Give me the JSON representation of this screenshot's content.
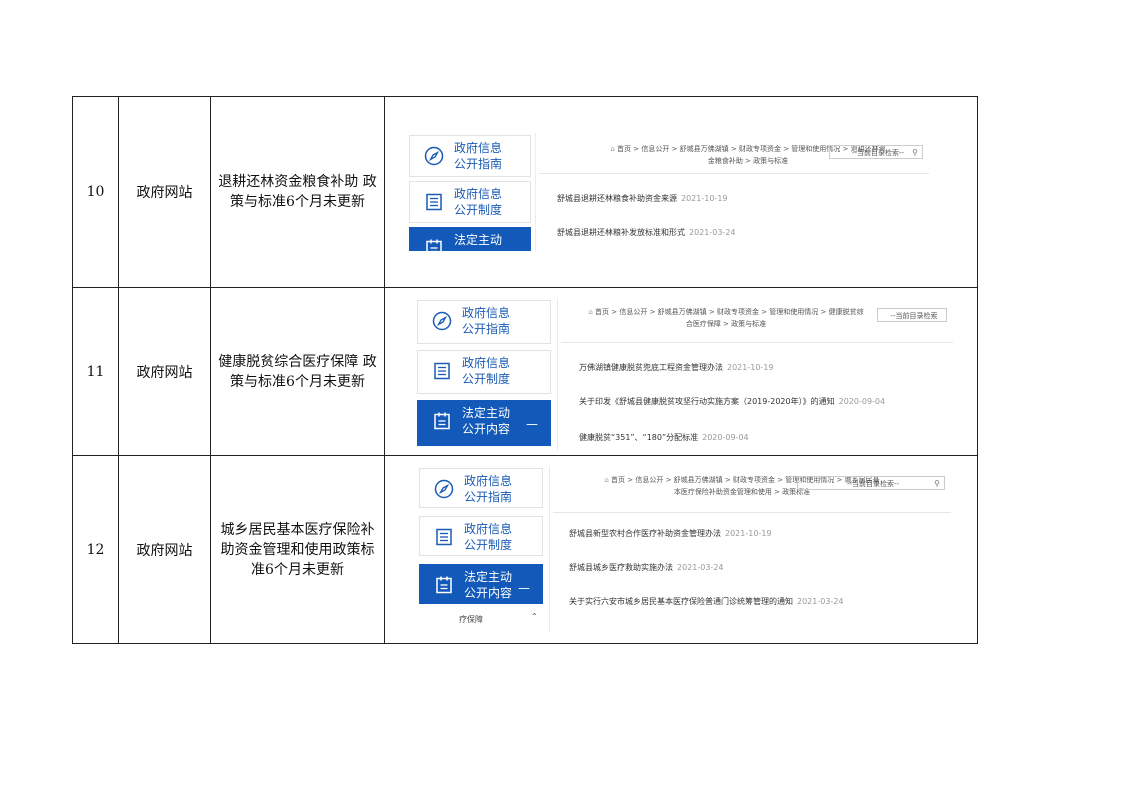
{
  "rows": [
    {
      "no": "10",
      "type": "政府网站",
      "desc_lines": [
        "退耕还林资金粮食补助 政",
        "策与标准6个月未更新"
      ],
      "shot": {
        "cards": [
          "政府信息|公开指南",
          "政府信息|公开制度",
          "法定主动|"
        ],
        "breadcrumb": [
          "首页 > 信息公开 > 舒城县万佛湖镇 > 财政专项资金 > 管理和使用情况 > 退耕还林资",
          "金粮食补助 > 政策与标准"
        ],
        "search_placeholder": "--当前目录检索--",
        "items": [
          {
            "title": "舒城县退耕还林粮食补助资金来源",
            "date": "2021-10-19"
          },
          {
            "title": "舒城县退耕还林粮补发放标准和形式",
            "date": "2021-03-24"
          }
        ]
      }
    },
    {
      "no": "11",
      "type": "政府网站",
      "desc_lines": [
        "健康脱贫综合医疗保障 政",
        "策与标准6个月未更新"
      ],
      "shot": {
        "cards": [
          "政府信息|公开指南",
          "政府信息|公开制度",
          "法定主动|公开内容"
        ],
        "breadcrumb": [
          "首页 > 信息公开 > 舒城县万佛湖镇 > 财政专项资金 > 管理和使用情况 > 健康脱贫综",
          "合医疗保障 > 政策与标准"
        ],
        "search_placeholder": "--当前目录检索",
        "items": [
          {
            "title": "万佛湖镇健康脱贫兜底工程资金管理办法",
            "date": "2021-10-19"
          },
          {
            "title": "关于印发《舒城县健康脱贫攻坚行动实施方案（2019-2020年）》的通知",
            "date": "2020-09-04"
          },
          {
            "title": "健康脱贫“351”、“180”分配标准",
            "date": "2020-09-04"
          }
        ]
      }
    },
    {
      "no": "12",
      "type": "政府网站",
      "desc_lines": [
        "城乡居民基本医疗保险补",
        "助资金管理和使用政策标",
        "准6个月未更新"
      ],
      "shot": {
        "cards": [
          "政府信息|公开指南",
          "政府信息|公开制度",
          "法定主动|公开内容"
        ],
        "extra_nav": "疗保障",
        "breadcrumb": [
          "首页 > 信息公开 > 舒城县万佛湖镇 > 财政专项资金 > 管理和使用情况 > 城乡居民基",
          "本医疗保险补助资金管理和使用 > 政策标准"
        ],
        "search_placeholder": "--当前目录检索--",
        "items": [
          {
            "title": "舒城县新型农村合作医疗补助资金管理办法",
            "date": "2021-10-19"
          },
          {
            "title": "舒城县城乡医疗救助实施办法",
            "date": "2021-03-24"
          },
          {
            "title": "关于实行六安市城乡居民基本医疗保险普通门诊统筹管理的通知",
            "date": "2021-03-24"
          }
        ]
      }
    }
  ]
}
